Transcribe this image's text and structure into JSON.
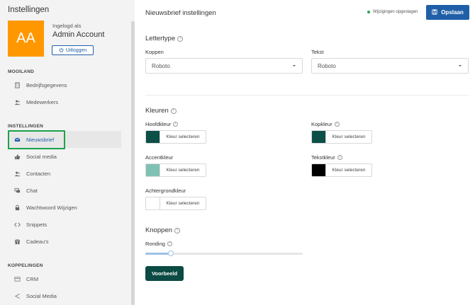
{
  "sidebar": {
    "title": "Instellingen",
    "avatar_initials": "AA",
    "avatar_color": "#ff9800",
    "login_label": "Ingelogd als",
    "account_name": "Admin Account",
    "logout_label": "Uitloggen",
    "sections": [
      {
        "label": "MOOILAND",
        "items": [
          {
            "label": "Bedrijfsgegevens",
            "icon": "building-icon"
          },
          {
            "label": "Medewerkers",
            "icon": "users-icon"
          }
        ]
      },
      {
        "label": "INSTELLINGEN",
        "items": [
          {
            "label": "Nieuwsbrief",
            "icon": "envelope-icon",
            "active": true
          },
          {
            "label": "Social media",
            "icon": "thumbs-up-icon"
          },
          {
            "label": "Contacten",
            "icon": "contacts-icon"
          },
          {
            "label": "Chat",
            "icon": "chat-icon"
          },
          {
            "label": "Wachtwoord Wijzigen",
            "icon": "lock-icon"
          },
          {
            "label": "Snippets",
            "icon": "code-icon"
          },
          {
            "label": "Cadeau's",
            "icon": "gift-icon"
          }
        ]
      },
      {
        "label": "KOPPELINGEN",
        "items": [
          {
            "label": "CRM",
            "icon": "crm-icon"
          },
          {
            "label": "Social Media",
            "icon": "share-icon"
          }
        ]
      }
    ]
  },
  "header": {
    "title": "Nieuwsbrief instellingen",
    "status": "Wijzigingen opgeslagen",
    "status_color": "#2e9e5b",
    "save_label": "Opslaan",
    "accent": "#1f5fa8"
  },
  "font": {
    "heading": "Lettertype",
    "koppen_label": "Koppen",
    "koppen_value": "Roboto",
    "tekst_label": "Tekst",
    "tekst_value": "Roboto"
  },
  "colors": {
    "heading": "Kleuren",
    "pick_label": "Kleur selecteren",
    "items": [
      {
        "label": "Hoofdkleur",
        "value": "#0b4f47"
      },
      {
        "label": "Kopkleur",
        "value": "#0b4f47"
      },
      {
        "label": "Accentkleur",
        "value": "#7fc2b3"
      },
      {
        "label": "Tekstkleur",
        "value": "#000000"
      },
      {
        "label": "Achtergrondkleur",
        "value": "#ffffff"
      }
    ]
  },
  "buttons": {
    "heading": "Knoppen",
    "ronding_label": "Ronding",
    "ronding_fraction": 0.16,
    "preview_label": "Voorbeeld",
    "preview_color": "#0c4a44"
  }
}
